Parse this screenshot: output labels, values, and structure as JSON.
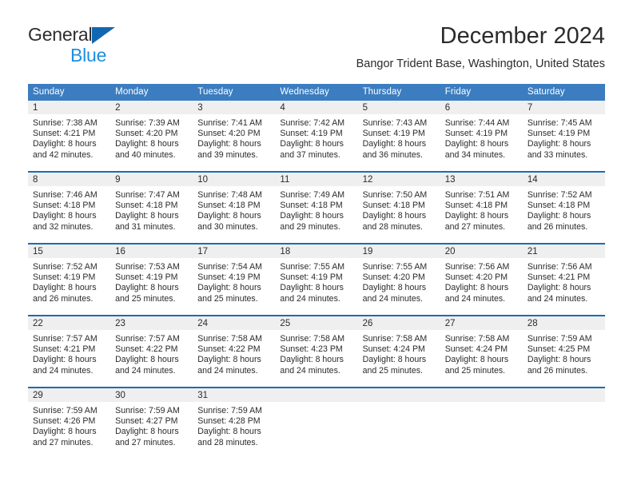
{
  "brand": {
    "name_part1": "General",
    "name_part2": "Blue",
    "logo_icon": "triangle-icon",
    "color_dark": "#2e2e2e",
    "color_blue": "#1b8fe3",
    "color_triangle": "#1267b1"
  },
  "header": {
    "title": "December 2024",
    "subtitle": "Bangor Trident Base, Washington, United States"
  },
  "theme": {
    "header_row_bg": "#3b7dc0",
    "row_divider": "#1d6cb1",
    "daynum_bg": "#efefef",
    "text": "#2b2b2b"
  },
  "weekdays": [
    "Sunday",
    "Monday",
    "Tuesday",
    "Wednesday",
    "Thursday",
    "Friday",
    "Saturday"
  ],
  "weeks": [
    [
      {
        "day": "1",
        "sunrise": "Sunrise: 7:38 AM",
        "sunset": "Sunset: 4:21 PM",
        "daylight1": "Daylight: 8 hours",
        "daylight2": "and 42 minutes."
      },
      {
        "day": "2",
        "sunrise": "Sunrise: 7:39 AM",
        "sunset": "Sunset: 4:20 PM",
        "daylight1": "Daylight: 8 hours",
        "daylight2": "and 40 minutes."
      },
      {
        "day": "3",
        "sunrise": "Sunrise: 7:41 AM",
        "sunset": "Sunset: 4:20 PM",
        "daylight1": "Daylight: 8 hours",
        "daylight2": "and 39 minutes."
      },
      {
        "day": "4",
        "sunrise": "Sunrise: 7:42 AM",
        "sunset": "Sunset: 4:19 PM",
        "daylight1": "Daylight: 8 hours",
        "daylight2": "and 37 minutes."
      },
      {
        "day": "5",
        "sunrise": "Sunrise: 7:43 AM",
        "sunset": "Sunset: 4:19 PM",
        "daylight1": "Daylight: 8 hours",
        "daylight2": "and 36 minutes."
      },
      {
        "day": "6",
        "sunrise": "Sunrise: 7:44 AM",
        "sunset": "Sunset: 4:19 PM",
        "daylight1": "Daylight: 8 hours",
        "daylight2": "and 34 minutes."
      },
      {
        "day": "7",
        "sunrise": "Sunrise: 7:45 AM",
        "sunset": "Sunset: 4:19 PM",
        "daylight1": "Daylight: 8 hours",
        "daylight2": "and 33 minutes."
      }
    ],
    [
      {
        "day": "8",
        "sunrise": "Sunrise: 7:46 AM",
        "sunset": "Sunset: 4:18 PM",
        "daylight1": "Daylight: 8 hours",
        "daylight2": "and 32 minutes."
      },
      {
        "day": "9",
        "sunrise": "Sunrise: 7:47 AM",
        "sunset": "Sunset: 4:18 PM",
        "daylight1": "Daylight: 8 hours",
        "daylight2": "and 31 minutes."
      },
      {
        "day": "10",
        "sunrise": "Sunrise: 7:48 AM",
        "sunset": "Sunset: 4:18 PM",
        "daylight1": "Daylight: 8 hours",
        "daylight2": "and 30 minutes."
      },
      {
        "day": "11",
        "sunrise": "Sunrise: 7:49 AM",
        "sunset": "Sunset: 4:18 PM",
        "daylight1": "Daylight: 8 hours",
        "daylight2": "and 29 minutes."
      },
      {
        "day": "12",
        "sunrise": "Sunrise: 7:50 AM",
        "sunset": "Sunset: 4:18 PM",
        "daylight1": "Daylight: 8 hours",
        "daylight2": "and 28 minutes."
      },
      {
        "day": "13",
        "sunrise": "Sunrise: 7:51 AM",
        "sunset": "Sunset: 4:18 PM",
        "daylight1": "Daylight: 8 hours",
        "daylight2": "and 27 minutes."
      },
      {
        "day": "14",
        "sunrise": "Sunrise: 7:52 AM",
        "sunset": "Sunset: 4:18 PM",
        "daylight1": "Daylight: 8 hours",
        "daylight2": "and 26 minutes."
      }
    ],
    [
      {
        "day": "15",
        "sunrise": "Sunrise: 7:52 AM",
        "sunset": "Sunset: 4:19 PM",
        "daylight1": "Daylight: 8 hours",
        "daylight2": "and 26 minutes."
      },
      {
        "day": "16",
        "sunrise": "Sunrise: 7:53 AM",
        "sunset": "Sunset: 4:19 PM",
        "daylight1": "Daylight: 8 hours",
        "daylight2": "and 25 minutes."
      },
      {
        "day": "17",
        "sunrise": "Sunrise: 7:54 AM",
        "sunset": "Sunset: 4:19 PM",
        "daylight1": "Daylight: 8 hours",
        "daylight2": "and 25 minutes."
      },
      {
        "day": "18",
        "sunrise": "Sunrise: 7:55 AM",
        "sunset": "Sunset: 4:19 PM",
        "daylight1": "Daylight: 8 hours",
        "daylight2": "and 24 minutes."
      },
      {
        "day": "19",
        "sunrise": "Sunrise: 7:55 AM",
        "sunset": "Sunset: 4:20 PM",
        "daylight1": "Daylight: 8 hours",
        "daylight2": "and 24 minutes."
      },
      {
        "day": "20",
        "sunrise": "Sunrise: 7:56 AM",
        "sunset": "Sunset: 4:20 PM",
        "daylight1": "Daylight: 8 hours",
        "daylight2": "and 24 minutes."
      },
      {
        "day": "21",
        "sunrise": "Sunrise: 7:56 AM",
        "sunset": "Sunset: 4:21 PM",
        "daylight1": "Daylight: 8 hours",
        "daylight2": "and 24 minutes."
      }
    ],
    [
      {
        "day": "22",
        "sunrise": "Sunrise: 7:57 AM",
        "sunset": "Sunset: 4:21 PM",
        "daylight1": "Daylight: 8 hours",
        "daylight2": "and 24 minutes."
      },
      {
        "day": "23",
        "sunrise": "Sunrise: 7:57 AM",
        "sunset": "Sunset: 4:22 PM",
        "daylight1": "Daylight: 8 hours",
        "daylight2": "and 24 minutes."
      },
      {
        "day": "24",
        "sunrise": "Sunrise: 7:58 AM",
        "sunset": "Sunset: 4:22 PM",
        "daylight1": "Daylight: 8 hours",
        "daylight2": "and 24 minutes."
      },
      {
        "day": "25",
        "sunrise": "Sunrise: 7:58 AM",
        "sunset": "Sunset: 4:23 PM",
        "daylight1": "Daylight: 8 hours",
        "daylight2": "and 24 minutes."
      },
      {
        "day": "26",
        "sunrise": "Sunrise: 7:58 AM",
        "sunset": "Sunset: 4:24 PM",
        "daylight1": "Daylight: 8 hours",
        "daylight2": "and 25 minutes."
      },
      {
        "day": "27",
        "sunrise": "Sunrise: 7:58 AM",
        "sunset": "Sunset: 4:24 PM",
        "daylight1": "Daylight: 8 hours",
        "daylight2": "and 25 minutes."
      },
      {
        "day": "28",
        "sunrise": "Sunrise: 7:59 AM",
        "sunset": "Sunset: 4:25 PM",
        "daylight1": "Daylight: 8 hours",
        "daylight2": "and 26 minutes."
      }
    ],
    [
      {
        "day": "29",
        "sunrise": "Sunrise: 7:59 AM",
        "sunset": "Sunset: 4:26 PM",
        "daylight1": "Daylight: 8 hours",
        "daylight2": "and 27 minutes."
      },
      {
        "day": "30",
        "sunrise": "Sunrise: 7:59 AM",
        "sunset": "Sunset: 4:27 PM",
        "daylight1": "Daylight: 8 hours",
        "daylight2": "and 27 minutes."
      },
      {
        "day": "31",
        "sunrise": "Sunrise: 7:59 AM",
        "sunset": "Sunset: 4:28 PM",
        "daylight1": "Daylight: 8 hours",
        "daylight2": "and 28 minutes."
      },
      {
        "day": "",
        "sunrise": "",
        "sunset": "",
        "daylight1": "",
        "daylight2": ""
      },
      {
        "day": "",
        "sunrise": "",
        "sunset": "",
        "daylight1": "",
        "daylight2": ""
      },
      {
        "day": "",
        "sunrise": "",
        "sunset": "",
        "daylight1": "",
        "daylight2": ""
      },
      {
        "day": "",
        "sunrise": "",
        "sunset": "",
        "daylight1": "",
        "daylight2": ""
      }
    ]
  ]
}
